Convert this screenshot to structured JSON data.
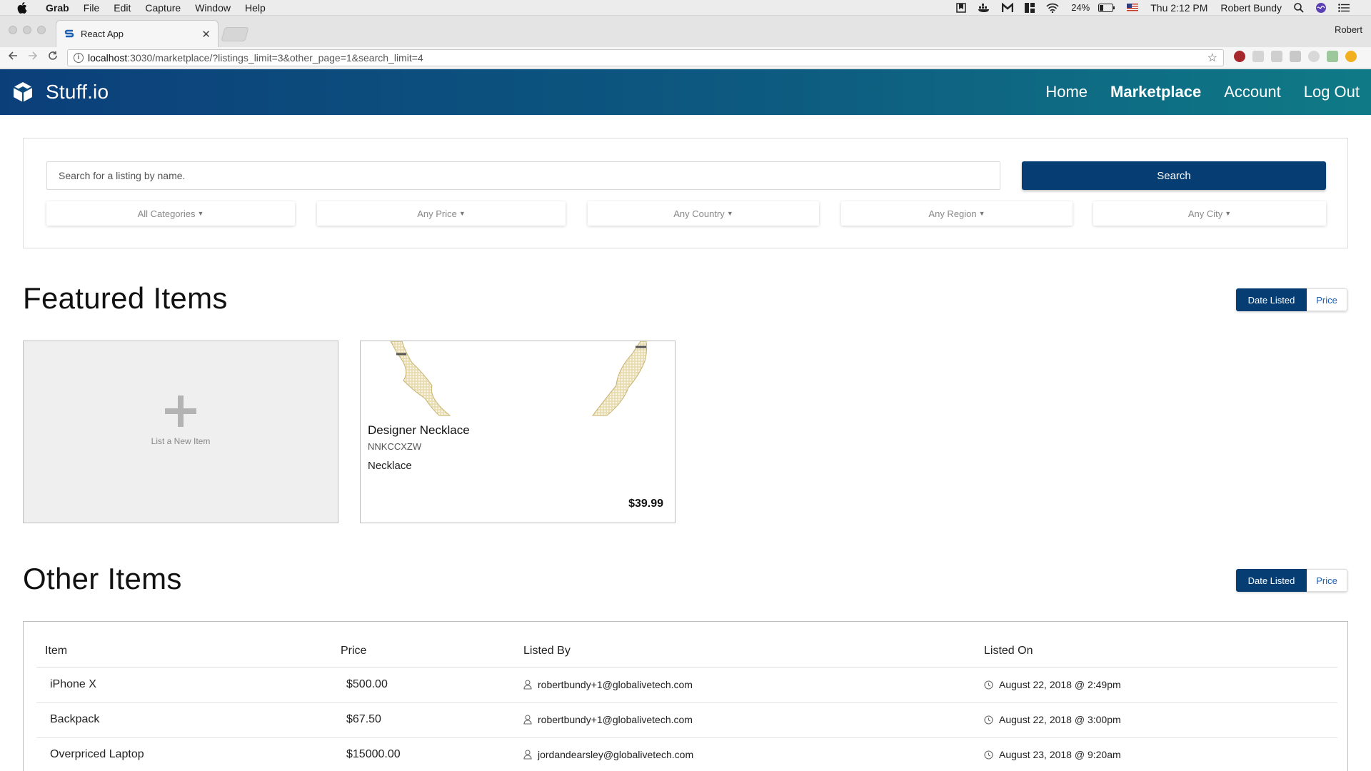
{
  "menubar": {
    "app_name": "Grab",
    "menus": [
      "File",
      "Edit",
      "Capture",
      "Window",
      "Help"
    ],
    "battery": "24%",
    "clock": "Thu 2:12 PM",
    "user": "Robert Bundy"
  },
  "browser": {
    "tab_title": "React App",
    "profile": "Robert",
    "url_host": "localhost",
    "url_path": ":3030/marketplace/?listings_limit=3&other_page=1&search_limit=4"
  },
  "header": {
    "brand": "Stuff.io",
    "nav": [
      "Home",
      "Marketplace",
      "Account",
      "Log Out"
    ],
    "active_nav": "Marketplace",
    "colors": {
      "gradient_start": "#0b3f7a",
      "gradient_end": "#0f7a86"
    }
  },
  "search": {
    "placeholder": "Search for a listing by name.",
    "button_label": "Search",
    "filters": [
      "All Categories",
      "Any Price",
      "Any Country",
      "Any Region",
      "Any City"
    ]
  },
  "featured": {
    "title": "Featured Items",
    "sort_options": [
      "Date Listed",
      "Price"
    ],
    "sort_active": "Date Listed",
    "new_item_label": "List a New Item",
    "items": [
      {
        "title": "Designer Necklace",
        "code": "NNKCCXZW",
        "category": "Necklace",
        "price": "$39.99"
      }
    ]
  },
  "other": {
    "title": "Other Items",
    "sort_options": [
      "Date Listed",
      "Price"
    ],
    "sort_active": "Date Listed",
    "columns": [
      "Item",
      "Price",
      "Listed By",
      "Listed On"
    ],
    "rows": [
      {
        "item": "iPhone X",
        "price": "$500.00",
        "listed_by": "robertbundy+1@globalivetech.com",
        "listed_on": "August 22, 2018 @ 2:49pm"
      },
      {
        "item": "Backpack",
        "price": "$67.50",
        "listed_by": "robertbundy+1@globalivetech.com",
        "listed_on": "August 22, 2018 @ 3:00pm"
      },
      {
        "item": "Overpriced Laptop",
        "price": "$15000.00",
        "listed_by": "jordandearsley@globalivetech.com",
        "listed_on": "August 23, 2018 @ 9:20am"
      }
    ]
  }
}
